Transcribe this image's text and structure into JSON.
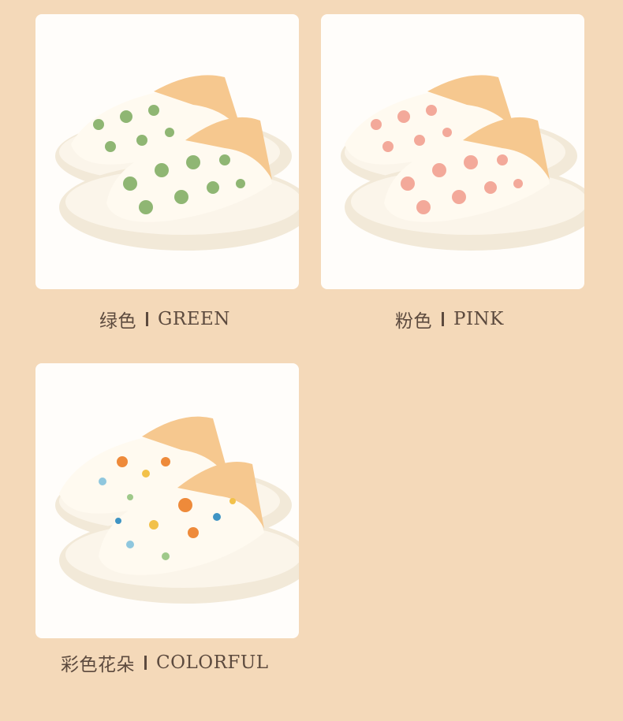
{
  "variants": [
    {
      "zh": "绿色",
      "en": "GREEN",
      "print_color": "#8fb673"
    },
    {
      "zh": "粉色",
      "en": "PINK",
      "print_color": "#f3a99a"
    },
    {
      "zh": "彩色花朵",
      "en": "COLORFUL",
      "print_color": "#ee8a3a"
    }
  ],
  "colors": {
    "background": "#f4d9b9",
    "card": "#fffdfa",
    "sole": "#f6eddc",
    "cuff": "#f6c88f",
    "text": "#5c4a3e"
  }
}
